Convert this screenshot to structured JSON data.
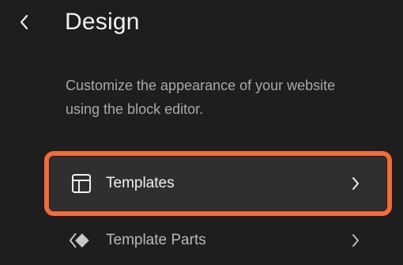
{
  "header": {
    "title": "Design",
    "back_icon": "chevron-left-icon"
  },
  "description": "Customize the appearance of your website using the block editor.",
  "menu": {
    "items": [
      {
        "label": "Templates",
        "icon": "layout-icon",
        "chevron": "chevron-right-icon",
        "active": true
      },
      {
        "label": "Template Parts",
        "icon": "symbol-icon",
        "chevron": "chevron-right-icon",
        "active": false
      }
    ]
  },
  "colors": {
    "background": "#1e1e1e",
    "active_item_background": "#2f2f2f",
    "highlight_outline": "#f26b3a",
    "description_text": "#a8a8a8"
  }
}
